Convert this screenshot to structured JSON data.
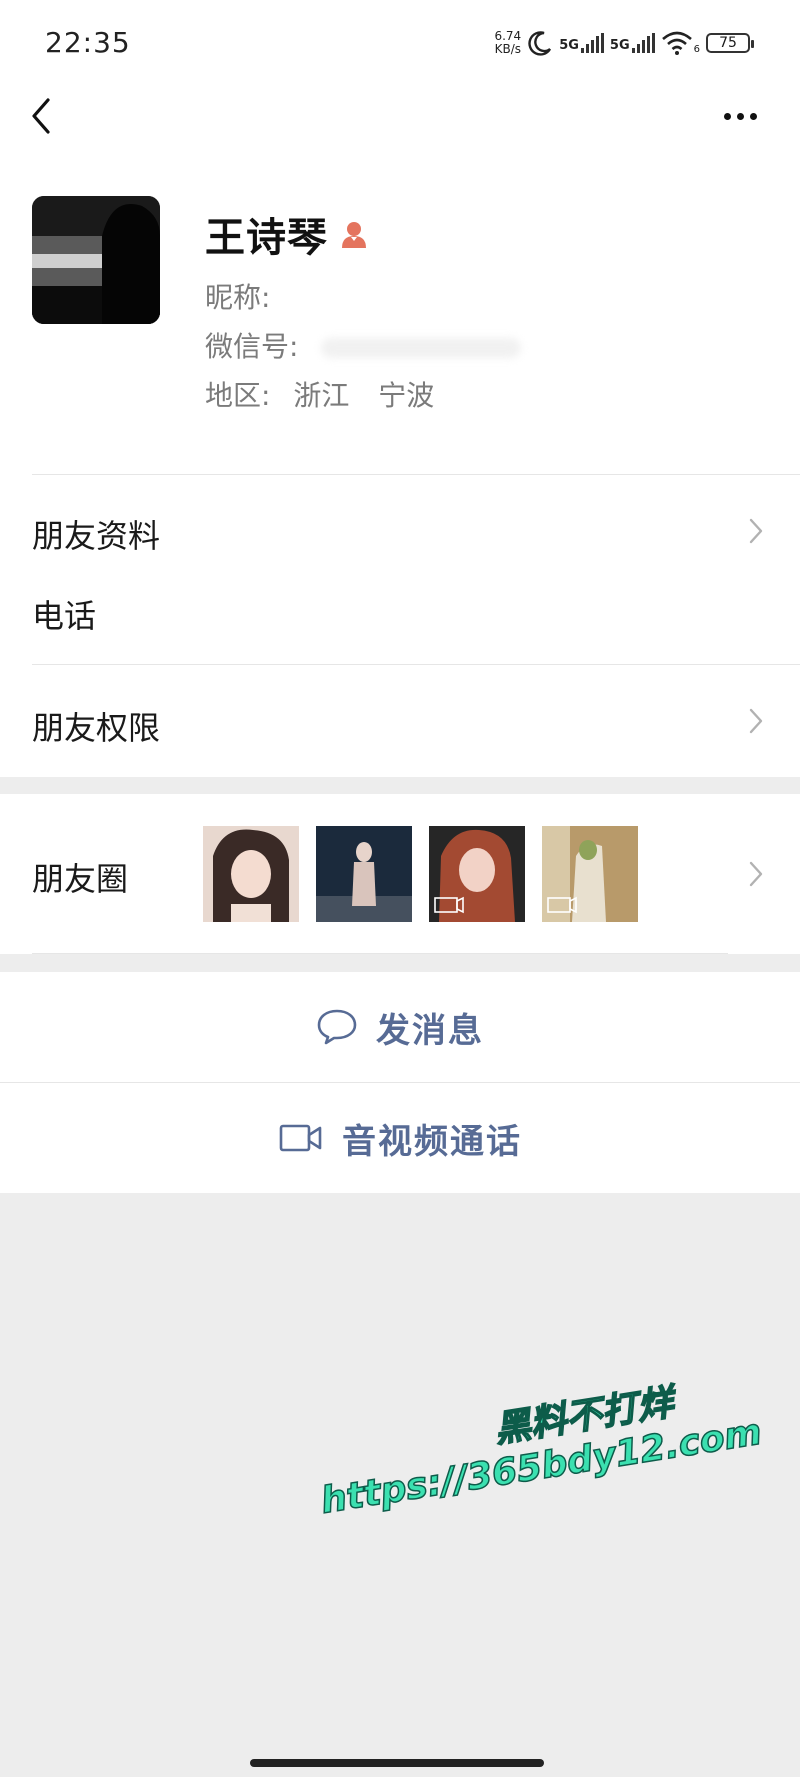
{
  "status_bar": {
    "time": "22:35",
    "speed_value": "6.74",
    "speed_unit": "KB/s",
    "net1": "5G",
    "net2": "5G",
    "wifi_sub": "6",
    "battery": "75"
  },
  "profile": {
    "name": "王诗琴",
    "nickname_label": "昵称:",
    "wechat_id_label": "微信号:",
    "region_label": "地区:",
    "region_province": "浙江",
    "region_city": "宁波"
  },
  "rows": {
    "friend_info": "朋友资料",
    "phone": "电话",
    "permissions": "朋友权限",
    "moments": "朋友圈"
  },
  "actions": {
    "message": "发消息",
    "call": "音视频通话"
  },
  "watermark": {
    "line1": "黑料不打烊",
    "line2": "https://365bdy12.com"
  },
  "colors": {
    "link_blue": "#576b95",
    "background": "#ededed",
    "gender_icon": "#e4745e",
    "watermark": "#3be0b0"
  },
  "icons": [
    "back-arrow-icon",
    "more-dots-icon",
    "gender-female-icon",
    "chevron-right-icon",
    "chat-bubble-icon",
    "video-camera-icon"
  ]
}
